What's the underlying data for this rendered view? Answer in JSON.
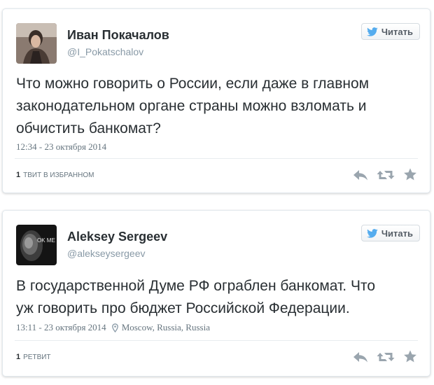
{
  "colors": {
    "icon_gray": "#9aa5ae",
    "twitter_blue": "#55acee",
    "name": "#292f33",
    "handle": "#8899a6"
  },
  "tweets": [
    {
      "author_name": "Иван Покачалов",
      "handle": "@I_Pokatschalov",
      "follow_label": "Читать",
      "text": "Что можно говорить о России, если даже в главном\nзаконодательном органе страны можно взломать и\nобчистить банкомат?",
      "timestamp": "12:34 - 23 октября 2014",
      "stat_count": "1",
      "stat_label": "ТВИТ В ИЗБРАННОМ"
    },
    {
      "author_name": "Aleksey Sergeev",
      "handle": "@alekseysergeev",
      "follow_label": "Читать",
      "text": "В государственной Думе РФ ограблен банкомат. Что\nуж говорить про бюджет Российской Федерации.",
      "timestamp": "13:11 - 23 октября 2014",
      "location": "Moscow, Russia, Russia",
      "stat_count": "1",
      "stat_label": "РЕТВИТ",
      "avatar_text": "OK ME"
    }
  ]
}
